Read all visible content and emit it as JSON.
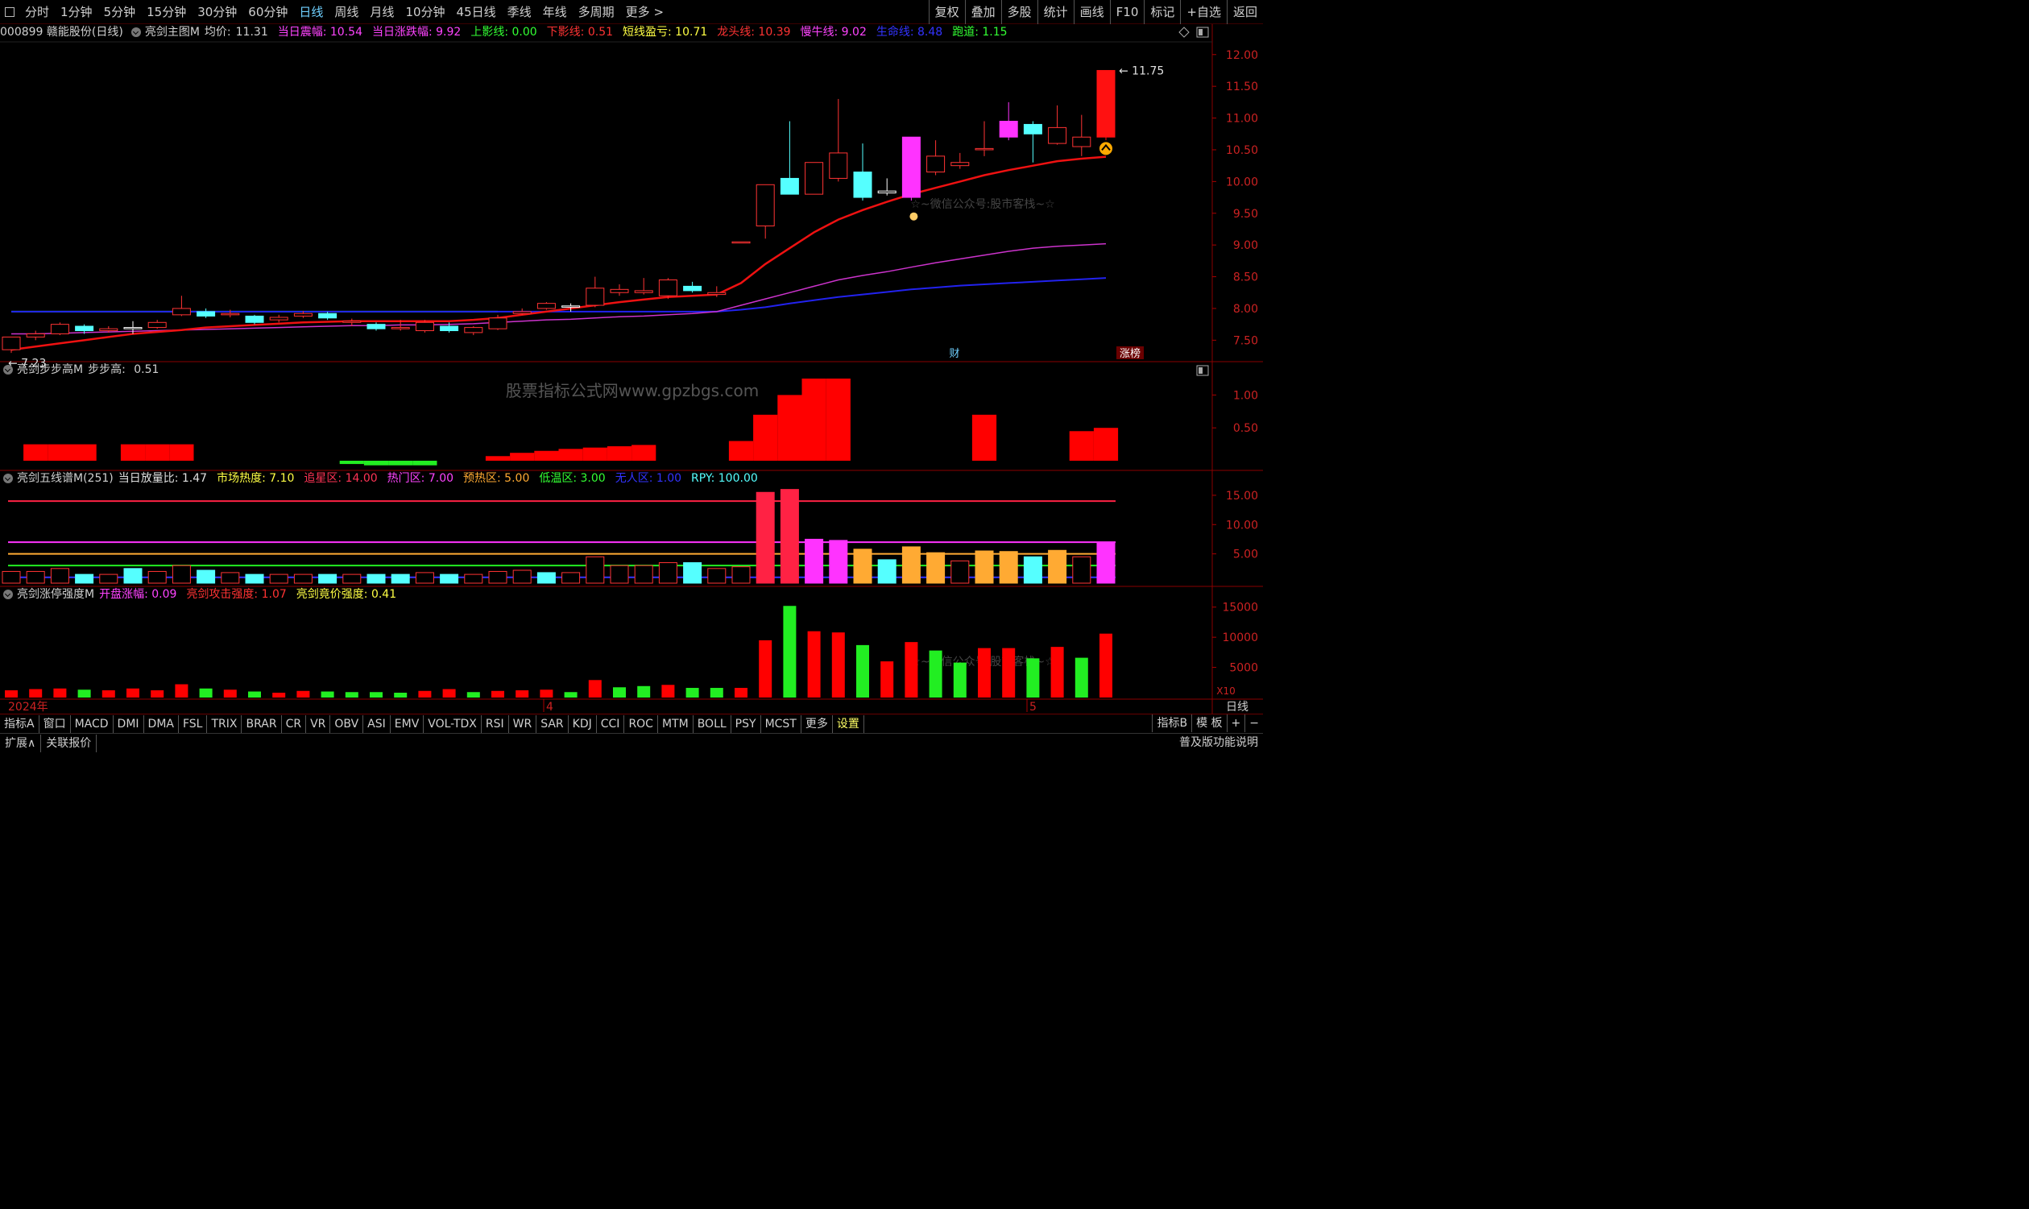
{
  "topbar": {
    "periods": [
      "分时",
      "1分钟",
      "5分钟",
      "15分钟",
      "30分钟",
      "60分钟",
      "日线",
      "周线",
      "月线",
      "10分钟",
      "45日线",
      "季线",
      "年线",
      "多周期",
      "更多 >"
    ],
    "active": "日线",
    "right_buttons": [
      "复权",
      "叠加",
      "多股",
      "统计",
      "画线",
      "F10",
      "标记",
      "+自选",
      "返回"
    ]
  },
  "main_info": {
    "stock": "000899 赣能股份(日线)",
    "indicator": "亮剑主图M",
    "avg_label": "均价:",
    "avg_value": "11.31",
    "items": [
      {
        "label": "当日震幅:",
        "value": "10.54",
        "color": "#ff44ff"
      },
      {
        "label": "当日涨跌幅:",
        "value": "9.92",
        "color": "#ff44ff"
      },
      {
        "label": "上影线:",
        "value": "0.00",
        "color": "#33ff33"
      },
      {
        "label": "下影线:",
        "value": "0.51",
        "color": "#ff3333"
      },
      {
        "label": "短线盈亏:",
        "value": "10.71",
        "color": "#ffff44"
      },
      {
        "label": "龙头线:",
        "value": "10.39",
        "color": "#ff3333"
      },
      {
        "label": "慢牛线:",
        "value": "9.02",
        "color": "#ff44ff"
      },
      {
        "label": "生命线:",
        "value": "8.48",
        "color": "#3333ff"
      },
      {
        "label": "跑道:",
        "value": "1.15",
        "color": "#33ff33"
      }
    ],
    "high_label": "11.75",
    "low_label": "7.23",
    "watermark": "☆~微信公众号:股市客栈~☆",
    "marker_cai": "财",
    "marker_zt": "涨榜"
  },
  "main_axis": [
    "12.00",
    "11.50",
    "11.00",
    "10.50",
    "10.00",
    "9.50",
    "9.00",
    "8.50",
    "8.00",
    "7.50"
  ],
  "panel2": {
    "title": "亮剑步步高M",
    "label": "步步高:",
    "value": "0.51",
    "watermark": "股票指标公式网www.gpzbgs.com",
    "axis": [
      "1.00",
      "0.50"
    ]
  },
  "panel3": {
    "title": "亮剑五线谱M(251)",
    "items": [
      {
        "label": "当日放量比:",
        "value": "1.47",
        "color": "#e0e0e0"
      },
      {
        "label": "市场热度:",
        "value": "7.10",
        "color": "#ffff44"
      },
      {
        "label": "追星区:",
        "value": "14.00",
        "color": "#ff3355"
      },
      {
        "label": "热门区:",
        "value": "7.00",
        "color": "#ff44ff"
      },
      {
        "label": "预热区:",
        "value": "5.00",
        "color": "#ffaa33"
      },
      {
        "label": "低温区:",
        "value": "3.00",
        "color": "#33ff33"
      },
      {
        "label": "无人区:",
        "value": "1.00",
        "color": "#3333ff"
      },
      {
        "label": "RPY:",
        "value": "100.00",
        "color": "#55ffff"
      }
    ],
    "axis": [
      "15.00",
      "10.00",
      "5.00"
    ]
  },
  "panel4": {
    "title": "亮剑涨停强度M",
    "items": [
      {
        "label": "开盘涨幅:",
        "value": "0.09",
        "color": "#ff44ff"
      },
      {
        "label": "亮剑攻击强度:",
        "value": "1.07",
        "color": "#ff3333"
      },
      {
        "label": "亮剑竟价强度:",
        "value": "0.41",
        "color": "#ffff44"
      }
    ],
    "axis": [
      "15000",
      "10000",
      "5000"
    ],
    "scale": "X10",
    "watermark": "☆~微信公众号:股市客栈~☆"
  },
  "date_axis": {
    "labels": [
      "2024年",
      "4",
      "5"
    ],
    "right": "日线"
  },
  "bottom_tabs": [
    "指标A",
    "窗口",
    "MACD",
    "DMI",
    "DMA",
    "FSL",
    "TRIX",
    "BRAR",
    "CR",
    "VR",
    "OBV",
    "ASI",
    "EMV",
    "VOL-TDX",
    "RSI",
    "WR",
    "SAR",
    "KDJ",
    "CCI",
    "ROC",
    "MTM",
    "BOLL",
    "PSY",
    "MCST",
    "更多",
    "设置"
  ],
  "bottom_tab_selected": "设置",
  "bottom_right_tabs": [
    "指标B",
    "模 板",
    "+",
    "−"
  ],
  "bottom2_tabs": [
    "扩展∧",
    "关联报价"
  ],
  "bottom2_right": "普及版功能说明",
  "chart_data": {
    "type": "candlestick",
    "ylim": [
      7.2,
      12.2
    ],
    "candles": [
      [
        7.55,
        7.35,
        7.55,
        7.3,
        "up"
      ],
      [
        7.55,
        7.6,
        7.65,
        7.5,
        "up"
      ],
      [
        7.6,
        7.75,
        7.78,
        7.58,
        "up"
      ],
      [
        7.72,
        7.65,
        7.75,
        7.6,
        "down"
      ],
      [
        7.65,
        7.68,
        7.72,
        7.62,
        "up"
      ],
      [
        7.68,
        7.7,
        7.8,
        7.6,
        "dojiW"
      ],
      [
        7.7,
        7.78,
        7.82,
        7.68,
        "up"
      ],
      [
        7.9,
        8.0,
        8.2,
        7.88,
        "up"
      ],
      [
        7.95,
        7.88,
        8.0,
        7.85,
        "down"
      ],
      [
        7.92,
        7.9,
        7.98,
        7.86,
        "up"
      ],
      [
        7.88,
        7.78,
        7.9,
        7.75,
        "down"
      ],
      [
        7.82,
        7.86,
        7.9,
        7.78,
        "up"
      ],
      [
        7.88,
        7.92,
        7.96,
        7.85,
        "up"
      ],
      [
        7.92,
        7.85,
        7.95,
        7.82,
        "down"
      ],
      [
        7.8,
        7.78,
        7.84,
        7.72,
        "doji"
      ],
      [
        7.75,
        7.68,
        7.78,
        7.65,
        "down"
      ],
      [
        7.68,
        7.7,
        7.82,
        7.65,
        "up"
      ],
      [
        7.65,
        7.78,
        7.82,
        7.62,
        "up"
      ],
      [
        7.72,
        7.65,
        7.78,
        7.62,
        "down"
      ],
      [
        7.62,
        7.7,
        7.72,
        7.58,
        "up"
      ],
      [
        7.68,
        7.85,
        7.9,
        7.66,
        "up"
      ],
      [
        7.92,
        7.95,
        8.0,
        7.9,
        "up"
      ],
      [
        8.0,
        8.08,
        8.1,
        7.98,
        "up"
      ],
      [
        8.02,
        8.04,
        8.08,
        7.95,
        "dojiW"
      ],
      [
        8.05,
        8.32,
        8.5,
        8.02,
        "up"
      ],
      [
        8.25,
        8.3,
        8.38,
        8.2,
        "up"
      ],
      [
        8.25,
        8.28,
        8.48,
        8.22,
        "doji"
      ],
      [
        8.2,
        8.45,
        8.48,
        8.15,
        "up"
      ],
      [
        8.35,
        8.28,
        8.42,
        8.25,
        "down"
      ],
      [
        8.22,
        8.25,
        8.35,
        8.18,
        "doji"
      ],
      [
        9.04,
        9.05,
        9.05,
        9.04,
        "flat"
      ],
      [
        9.3,
        9.95,
        9.95,
        9.1,
        "up"
      ],
      [
        10.05,
        9.8,
        10.95,
        9.8,
        "down"
      ],
      [
        9.8,
        10.3,
        10.3,
        9.8,
        "up"
      ],
      [
        10.05,
        10.45,
        11.3,
        10.0,
        "up"
      ],
      [
        10.15,
        9.75,
        10.6,
        9.7,
        "down"
      ],
      [
        9.85,
        9.82,
        10.05,
        9.78,
        "dojiW"
      ],
      [
        9.75,
        10.7,
        10.7,
        9.7,
        "mag"
      ],
      [
        10.15,
        10.4,
        10.65,
        10.1,
        "up"
      ],
      [
        10.25,
        10.3,
        10.45,
        10.2,
        "doji"
      ],
      [
        10.5,
        10.52,
        10.95,
        10.4,
        "doji"
      ],
      [
        10.7,
        10.95,
        11.25,
        10.65,
        "mag"
      ],
      [
        10.9,
        10.75,
        10.95,
        10.3,
        "down"
      ],
      [
        10.6,
        10.85,
        11.2,
        10.58,
        "up"
      ],
      [
        10.55,
        10.7,
        11.05,
        10.4,
        "up"
      ],
      [
        10.7,
        11.75,
        11.75,
        10.65,
        "upfill"
      ]
    ],
    "lines": {
      "龙头线": [
        7.35,
        7.4,
        7.45,
        7.5,
        7.55,
        7.6,
        7.63,
        7.66,
        7.7,
        7.72,
        7.74,
        7.76,
        7.78,
        7.79,
        7.8,
        7.8,
        7.8,
        7.8,
        7.8,
        7.82,
        7.85,
        7.9,
        7.95,
        8.0,
        8.05,
        8.1,
        8.14,
        8.18,
        8.2,
        8.22,
        8.4,
        8.7,
        8.95,
        9.2,
        9.4,
        9.55,
        9.68,
        9.8,
        9.9,
        10.0,
        10.1,
        10.18,
        10.25,
        10.32,
        10.36,
        10.39
      ],
      "慢牛线": [
        7.6,
        7.6,
        7.61,
        7.62,
        7.63,
        7.64,
        7.65,
        7.66,
        7.67,
        7.68,
        7.69,
        7.7,
        7.71,
        7.72,
        7.73,
        7.73,
        7.74,
        7.74,
        7.75,
        7.76,
        7.78,
        7.8,
        7.82,
        7.83,
        7.85,
        7.87,
        7.88,
        7.9,
        7.92,
        7.95,
        8.05,
        8.15,
        8.25,
        8.35,
        8.45,
        8.52,
        8.58,
        8.65,
        8.72,
        8.78,
        8.84,
        8.9,
        8.95,
        8.98,
        9.0,
        9.02
      ],
      "生命线": [
        7.95,
        7.95,
        7.95,
        7.95,
        7.95,
        7.95,
        7.95,
        7.95,
        7.95,
        7.95,
        7.95,
        7.95,
        7.95,
        7.95,
        7.95,
        7.95,
        7.95,
        7.95,
        7.95,
        7.95,
        7.95,
        7.95,
        7.95,
        7.95,
        7.95,
        7.95,
        7.95,
        7.95,
        7.95,
        7.95,
        7.98,
        8.02,
        8.08,
        8.13,
        8.18,
        8.22,
        8.26,
        8.3,
        8.33,
        8.36,
        8.38,
        8.4,
        8.42,
        8.44,
        8.46,
        8.48
      ],
      "跑道": [
        7.95,
        7.95,
        7.95,
        7.95,
        7.95,
        7.95,
        7.95,
        7.95,
        7.95,
        7.95,
        7.95,
        7.95,
        7.95,
        7.95,
        7.95,
        7.95,
        7.95,
        7.95,
        7.95,
        7.95,
        7.95
      ]
    },
    "panel2_bars": [
      0,
      0.25,
      0.25,
      0.25,
      0,
      0.25,
      0.25,
      0.25,
      0,
      0,
      0,
      0,
      0,
      0,
      -0.05,
      -0.07,
      -0.07,
      -0.07,
      0,
      0,
      0.07,
      0.12,
      0.15,
      0.18,
      0.2,
      0.22,
      0.24,
      0,
      0,
      0,
      0.3,
      0.7,
      1.0,
      1.25,
      1.25,
      0,
      0,
      0,
      0,
      0,
      0.7,
      0,
      0,
      0,
      0.45,
      0.5
    ],
    "panel2_colors": [
      "g",
      "r",
      "r",
      "r",
      "g",
      "r",
      "r",
      "r",
      "g",
      "g",
      "g",
      "g",
      "g",
      "g",
      "G",
      "G",
      "G",
      "G",
      "g",
      "g",
      "r",
      "r",
      "r",
      "r",
      "r",
      "r",
      "r",
      "g",
      "g",
      "g",
      "r",
      "r",
      "r",
      "r",
      "r",
      "g",
      "g",
      "g",
      "g",
      "g",
      "r",
      "g",
      "g",
      "g",
      "r",
      "r"
    ],
    "panel3_bars": [
      2,
      2,
      2.5,
      1.5,
      1.5,
      2.5,
      2,
      3,
      2.2,
      1.8,
      1.5,
      1.5,
      1.5,
      1.5,
      1.5,
      1.5,
      1.5,
      1.8,
      1.5,
      1.5,
      2,
      2.2,
      1.8,
      1.8,
      4.5,
      3,
      3,
      3.5,
      3.5,
      2.5,
      2.8,
      15.5,
      16,
      7.5,
      7.3,
      5.8,
      4,
      6.2,
      5.2,
      3.8,
      5.5,
      5.4,
      4.5,
      5.6,
      4.5,
      7
    ],
    "panel3_styles": [
      "o",
      "o",
      "o",
      "c",
      "o",
      "c",
      "o",
      "o",
      "c",
      "o",
      "c",
      "o",
      "o",
      "c",
      "o",
      "c",
      "c",
      "o",
      "c",
      "o",
      "o",
      "o",
      "c",
      "o",
      "o",
      "o",
      "o",
      "o",
      "c",
      "o",
      "o",
      "R",
      "R",
      "M",
      "M",
      "Y",
      "C",
      "Y",
      "Y",
      "O",
      "Y",
      "Y",
      "C",
      "Y",
      "O",
      "M"
    ],
    "panel3_lines": {
      "追星区": 14,
      "热门区": 7,
      "预热区": 5,
      "低温区": 3,
      "无人区": 1
    },
    "panel4_bars": [
      1200,
      1400,
      1500,
      1300,
      1200,
      1500,
      1200,
      2200,
      1500,
      1300,
      1000,
      800,
      1100,
      1000,
      900,
      900,
      800,
      1100,
      1400,
      900,
      1100,
      1200,
      1300,
      900,
      2900,
      1700,
      1900,
      2100,
      1600,
      1600,
      1600,
      9500,
      15200,
      11000,
      10800,
      8700,
      6000,
      9200,
      7800,
      5800,
      8200,
      8200,
      6500,
      8400,
      6600,
      10600
    ],
    "panel4_colors": [
      "r",
      "r",
      "r",
      "g",
      "r",
      "r",
      "r",
      "r",
      "g",
      "r",
      "g",
      "r",
      "r",
      "g",
      "g",
      "g",
      "g",
      "r",
      "r",
      "g",
      "r",
      "r",
      "r",
      "g",
      "r",
      "g",
      "g",
      "r",
      "g",
      "g",
      "r",
      "r",
      "g",
      "r",
      "r",
      "g",
      "r",
      "r",
      "g",
      "g",
      "r",
      "r",
      "g",
      "r",
      "g",
      "r"
    ]
  }
}
